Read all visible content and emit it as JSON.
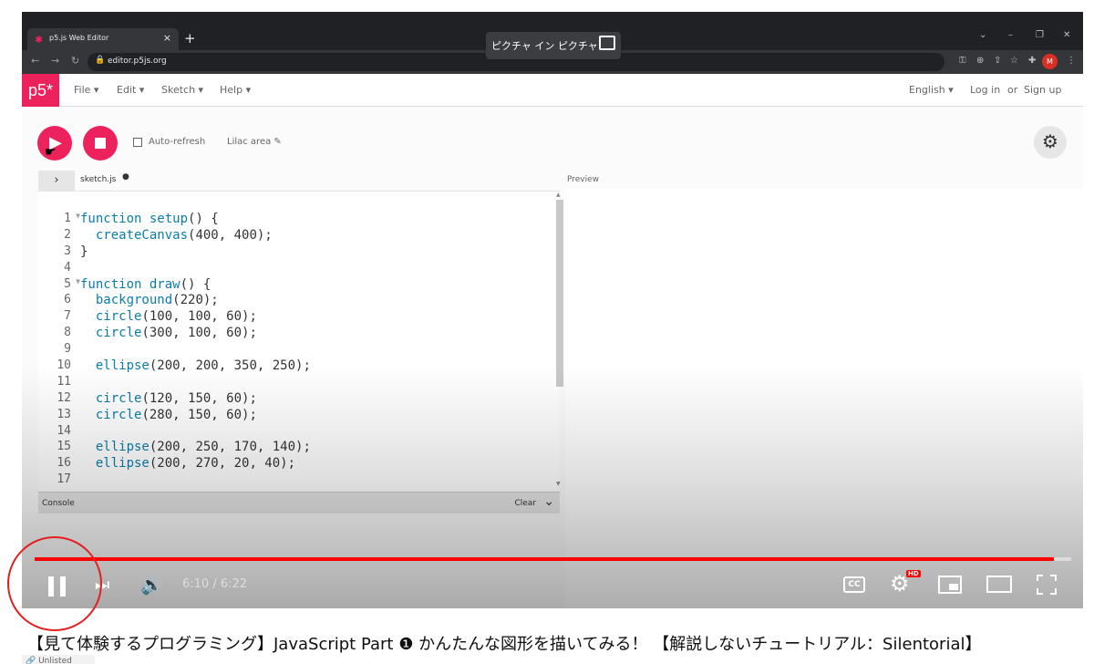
{
  "browser": {
    "tab_title": "p5.js Web Editor",
    "tab_close": "×",
    "new_tab": "+",
    "pip_label": "ピクチャ イン ピクチャ",
    "url": "editor.p5js.org",
    "window_controls": [
      "⌄",
      "–",
      "❐",
      "✕"
    ],
    "avatar_letter": "M"
  },
  "p5": {
    "logo": "p5*",
    "menu": [
      "File ▾",
      "Edit ▾",
      "Sketch ▾",
      "Help ▾"
    ],
    "language": "English ▾",
    "login": "Log in",
    "or": "or",
    "signup": "Sign up",
    "auto_refresh": "Auto-refresh",
    "sketch_name": "Lilac area ✎",
    "file_name": "sketch.js",
    "preview_label": "Preview",
    "console_label": "Console",
    "clear_label": "Clear",
    "code_lines": [
      {
        "n": "1",
        "fold": "▼",
        "parts": [
          {
            "c": "kw",
            "t": "function "
          },
          {
            "c": "fn",
            "t": "setup"
          },
          {
            "c": "",
            "t": "() {"
          }
        ]
      },
      {
        "n": "2",
        "fold": "",
        "parts": [
          {
            "c": "",
            "t": "  "
          },
          {
            "c": "fn",
            "t": "createCanvas"
          },
          {
            "c": "",
            "t": "(400, 400);"
          }
        ]
      },
      {
        "n": "3",
        "fold": "",
        "parts": [
          {
            "c": "",
            "t": "}"
          }
        ]
      },
      {
        "n": "4",
        "fold": "",
        "parts": []
      },
      {
        "n": "5",
        "fold": "▼",
        "parts": [
          {
            "c": "kw",
            "t": "function "
          },
          {
            "c": "fn",
            "t": "draw"
          },
          {
            "c": "",
            "t": "() {"
          }
        ]
      },
      {
        "n": "6",
        "fold": "",
        "parts": [
          {
            "c": "",
            "t": "  "
          },
          {
            "c": "fn",
            "t": "background"
          },
          {
            "c": "",
            "t": "(220);"
          }
        ]
      },
      {
        "n": "7",
        "fold": "",
        "parts": [
          {
            "c": "",
            "t": "  "
          },
          {
            "c": "fn",
            "t": "circle"
          },
          {
            "c": "",
            "t": "(100, 100, 60);"
          }
        ]
      },
      {
        "n": "8",
        "fold": "",
        "parts": [
          {
            "c": "",
            "t": "  "
          },
          {
            "c": "fn",
            "t": "circle"
          },
          {
            "c": "",
            "t": "(300, 100, 60);"
          }
        ]
      },
      {
        "n": "9",
        "fold": "",
        "parts": []
      },
      {
        "n": "10",
        "fold": "",
        "parts": [
          {
            "c": "",
            "t": "  "
          },
          {
            "c": "fn",
            "t": "ellipse"
          },
          {
            "c": "",
            "t": "(200, 200, 350, 250);"
          }
        ]
      },
      {
        "n": "11",
        "fold": "",
        "parts": []
      },
      {
        "n": "12",
        "fold": "",
        "parts": [
          {
            "c": "",
            "t": "  "
          },
          {
            "c": "fn",
            "t": "circle"
          },
          {
            "c": "",
            "t": "(120, 150, 60);"
          }
        ]
      },
      {
        "n": "13",
        "fold": "",
        "parts": [
          {
            "c": "",
            "t": "  "
          },
          {
            "c": "fn",
            "t": "circle"
          },
          {
            "c": "",
            "t": "(280, 150, 60);"
          }
        ]
      },
      {
        "n": "14",
        "fold": "",
        "parts": []
      },
      {
        "n": "15",
        "fold": "",
        "parts": [
          {
            "c": "",
            "t": "  "
          },
          {
            "c": "fn",
            "t": "ellipse"
          },
          {
            "c": "",
            "t": "(200, 250, 170, 140);"
          }
        ]
      },
      {
        "n": "16",
        "fold": "",
        "parts": [
          {
            "c": "",
            "t": "  "
          },
          {
            "c": "fn",
            "t": "ellipse"
          },
          {
            "c": "",
            "t": "(200, 270, 20, 40);"
          }
        ]
      },
      {
        "n": "17",
        "fold": "",
        "parts": []
      }
    ]
  },
  "player": {
    "time": "6:10 / 6:22",
    "progress": 0.983,
    "cc": "CC",
    "hd": "HD",
    "accent": "#ff0000"
  },
  "video": {
    "title": "【見て体験するプログラミング】JavaScript Part ❶ かんたんな図形を描いてみる！ 【解説しないチュートリアル：Silentorial】",
    "visibility": "Unlisted"
  }
}
